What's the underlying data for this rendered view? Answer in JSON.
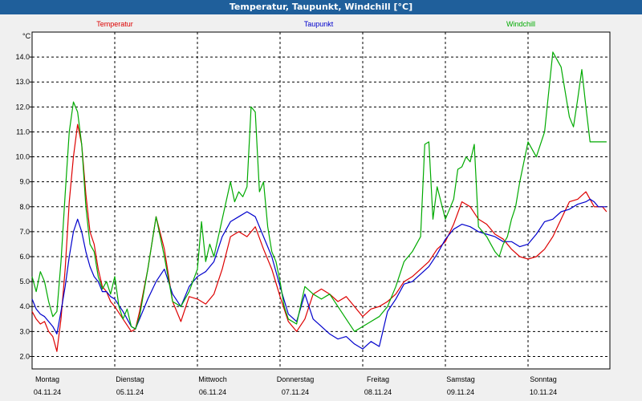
{
  "window": {
    "title": "Temperatur, Taupunkt, Windchill [°C]"
  },
  "chart_data": {
    "type": "line",
    "title": "Temperatur, Taupunkt, Windchill [°C]",
    "ylabel": "°C",
    "ylim": [
      1.5,
      15
    ],
    "xlim": [
      0,
      7
    ],
    "grid": true,
    "yticks": [
      "2.0",
      "3.0",
      "4.0",
      "5.0",
      "6.0",
      "7.0",
      "8.0",
      "9.0",
      "10.0",
      "11.0",
      "12.0",
      "13.0",
      "14.0"
    ],
    "day_labels": [
      {
        "day": "Montag",
        "date": "04.11.24"
      },
      {
        "day": "Dienstag",
        "date": "05.11.24"
      },
      {
        "day": "Mittwoch",
        "date": "06.11.24"
      },
      {
        "day": "Donnerstag",
        "date": "07.11.24"
      },
      {
        "day": "Freitag",
        "date": "08.11.24"
      },
      {
        "day": "Samstag",
        "date": "09.11.24"
      },
      {
        "day": "Sonntag",
        "date": "10.11.24"
      }
    ],
    "series": [
      {
        "name": "Temperatur",
        "color": "#dd0000",
        "x": [
          0,
          0.05,
          0.1,
          0.15,
          0.2,
          0.25,
          0.3,
          0.35,
          0.4,
          0.45,
          0.5,
          0.55,
          0.6,
          0.65,
          0.7,
          0.75,
          0.8,
          0.85,
          0.9,
          0.95,
          1.0,
          1.1,
          1.2,
          1.25,
          1.3,
          1.4,
          1.5,
          1.6,
          1.7,
          1.8,
          1.9,
          2.0,
          2.1,
          2.2,
          2.3,
          2.4,
          2.5,
          2.6,
          2.7,
          2.8,
          2.9,
          3.0,
          3.1,
          3.2,
          3.3,
          3.4,
          3.5,
          3.6,
          3.7,
          3.8,
          3.9,
          4.0,
          4.1,
          4.2,
          4.3,
          4.4,
          4.5,
          4.6,
          4.7,
          4.8,
          4.9,
          5.0,
          5.1,
          5.2,
          5.3,
          5.4,
          5.5,
          5.6,
          5.7,
          5.8,
          5.9,
          6.0,
          6.1,
          6.2,
          6.3,
          6.4,
          6.5,
          6.6,
          6.7,
          6.75,
          6.8,
          6.85,
          6.9,
          6.95
        ],
        "values": [
          3.8,
          3.5,
          3.3,
          3.4,
          3.0,
          2.8,
          2.2,
          3.5,
          5.5,
          8.2,
          10.0,
          11.3,
          10.5,
          8.5,
          7.0,
          6.5,
          5.5,
          4.8,
          4.6,
          4.2,
          4.0,
          3.5,
          3.0,
          3.1,
          3.8,
          5.5,
          7.6,
          6.3,
          4.2,
          3.4,
          4.4,
          4.3,
          4.1,
          4.5,
          5.5,
          6.8,
          7.0,
          6.8,
          7.2,
          6.3,
          5.5,
          4.4,
          3.4,
          3.0,
          3.5,
          4.5,
          4.7,
          4.5,
          4.2,
          4.4,
          4.0,
          3.6,
          3.9,
          4.0,
          4.2,
          4.5,
          5.0,
          5.2,
          5.5,
          5.8,
          6.3,
          6.6,
          7.3,
          8.2,
          8.0,
          7.5,
          7.3,
          6.9,
          6.7,
          6.3,
          6.0,
          5.9,
          6.0,
          6.3,
          6.8,
          7.5,
          8.2,
          8.3,
          8.6,
          8.3,
          8.0,
          8.0,
          8.0,
          7.8
        ]
      },
      {
        "name": "Taupunkt",
        "color": "#0000cc",
        "x": [
          0,
          0.05,
          0.1,
          0.15,
          0.2,
          0.25,
          0.3,
          0.35,
          0.4,
          0.45,
          0.5,
          0.55,
          0.6,
          0.65,
          0.7,
          0.75,
          0.8,
          0.85,
          0.9,
          0.95,
          1.0,
          1.1,
          1.2,
          1.25,
          1.3,
          1.4,
          1.5,
          1.6,
          1.7,
          1.8,
          1.9,
          2.0,
          2.1,
          2.2,
          2.3,
          2.4,
          2.5,
          2.6,
          2.7,
          2.8,
          2.9,
          3.0,
          3.1,
          3.2,
          3.3,
          3.4,
          3.5,
          3.6,
          3.7,
          3.8,
          3.9,
          4.0,
          4.1,
          4.2,
          4.3,
          4.4,
          4.5,
          4.6,
          4.7,
          4.8,
          4.9,
          5.0,
          5.1,
          5.2,
          5.3,
          5.4,
          5.5,
          5.6,
          5.7,
          5.8,
          5.9,
          6.0,
          6.1,
          6.2,
          6.3,
          6.4,
          6.5,
          6.6,
          6.7,
          6.75,
          6.8,
          6.85,
          6.9,
          6.95
        ],
        "values": [
          4.3,
          3.9,
          3.7,
          3.6,
          3.4,
          3.2,
          2.9,
          3.8,
          4.8,
          6.0,
          7.0,
          7.5,
          7.0,
          6.2,
          5.6,
          5.2,
          5.0,
          4.6,
          4.6,
          4.4,
          4.3,
          3.8,
          3.2,
          3.1,
          3.5,
          4.3,
          5.0,
          5.5,
          4.5,
          4.0,
          4.8,
          5.2,
          5.4,
          5.8,
          6.8,
          7.4,
          7.6,
          7.8,
          7.6,
          6.8,
          6.0,
          4.8,
          3.7,
          3.4,
          4.5,
          3.5,
          3.2,
          2.9,
          2.7,
          2.8,
          2.5,
          2.3,
          2.6,
          2.4,
          3.8,
          4.3,
          4.9,
          5.0,
          5.3,
          5.6,
          6.1,
          6.7,
          7.1,
          7.3,
          7.2,
          7.0,
          6.9,
          6.8,
          6.6,
          6.6,
          6.4,
          6.5,
          6.9,
          7.4,
          7.5,
          7.8,
          7.9,
          8.1,
          8.2,
          8.3,
          8.2,
          8.0,
          8.0,
          8.0
        ]
      },
      {
        "name": "Windchill",
        "color": "#00aa00",
        "x": [
          0,
          0.05,
          0.1,
          0.15,
          0.2,
          0.25,
          0.3,
          0.35,
          0.4,
          0.45,
          0.5,
          0.55,
          0.6,
          0.65,
          0.7,
          0.75,
          0.8,
          0.85,
          0.9,
          0.95,
          1.0,
          1.05,
          1.1,
          1.15,
          1.2,
          1.25,
          1.3,
          1.4,
          1.5,
          1.6,
          1.7,
          1.8,
          1.9,
          2.0,
          2.05,
          2.1,
          2.15,
          2.2,
          2.3,
          2.4,
          2.45,
          2.5,
          2.55,
          2.6,
          2.65,
          2.7,
          2.75,
          2.8,
          2.85,
          2.9,
          2.95,
          3.0,
          3.05,
          3.1,
          3.2,
          3.3,
          3.4,
          3.5,
          3.6,
          3.7,
          3.8,
          3.9,
          4.0,
          4.1,
          4.2,
          4.3,
          4.4,
          4.5,
          4.6,
          4.7,
          4.75,
          4.8,
          4.85,
          4.9,
          5.0,
          5.1,
          5.15,
          5.2,
          5.25,
          5.3,
          5.35,
          5.4,
          5.45,
          5.5,
          5.55,
          5.6,
          5.65,
          5.7,
          5.75,
          5.8,
          5.85,
          5.9,
          6.0,
          6.1,
          6.2,
          6.3,
          6.4,
          6.5,
          6.55,
          6.6,
          6.65,
          6.7,
          6.75,
          6.8,
          6.85,
          6.9,
          6.95
        ],
        "values": [
          5.2,
          4.6,
          5.4,
          5.0,
          4.2,
          3.6,
          3.8,
          5.8,
          8.5,
          11.0,
          12.2,
          11.8,
          10.5,
          8.0,
          6.5,
          6.2,
          5.2,
          4.7,
          5.0,
          4.5,
          5.2,
          4.0,
          3.5,
          3.9,
          3.2,
          3.1,
          3.6,
          5.5,
          7.6,
          6.0,
          4.2,
          4.0,
          4.6,
          5.5,
          7.4,
          5.8,
          6.5,
          6.0,
          7.5,
          9.0,
          8.2,
          8.6,
          8.4,
          8.8,
          12.0,
          11.8,
          8.6,
          9.0,
          7.2,
          6.2,
          5.8,
          5.0,
          4.0,
          3.5,
          3.3,
          4.8,
          4.5,
          4.3,
          4.5,
          4.0,
          3.5,
          3.0,
          3.2,
          3.4,
          3.6,
          4.0,
          4.8,
          5.8,
          6.2,
          6.8,
          10.5,
          10.6,
          7.5,
          8.8,
          7.5,
          8.3,
          9.5,
          9.6,
          10.0,
          9.8,
          10.5,
          7.2,
          7.0,
          6.8,
          6.5,
          6.2,
          6.0,
          6.5,
          6.8,
          7.5,
          8.0,
          9.0,
          10.6,
          10.0,
          11.0,
          14.2,
          13.6,
          11.6,
          11.2,
          12.3,
          13.5,
          12.0,
          10.6,
          10.6,
          10.6,
          10.6,
          10.6
        ]
      }
    ]
  }
}
